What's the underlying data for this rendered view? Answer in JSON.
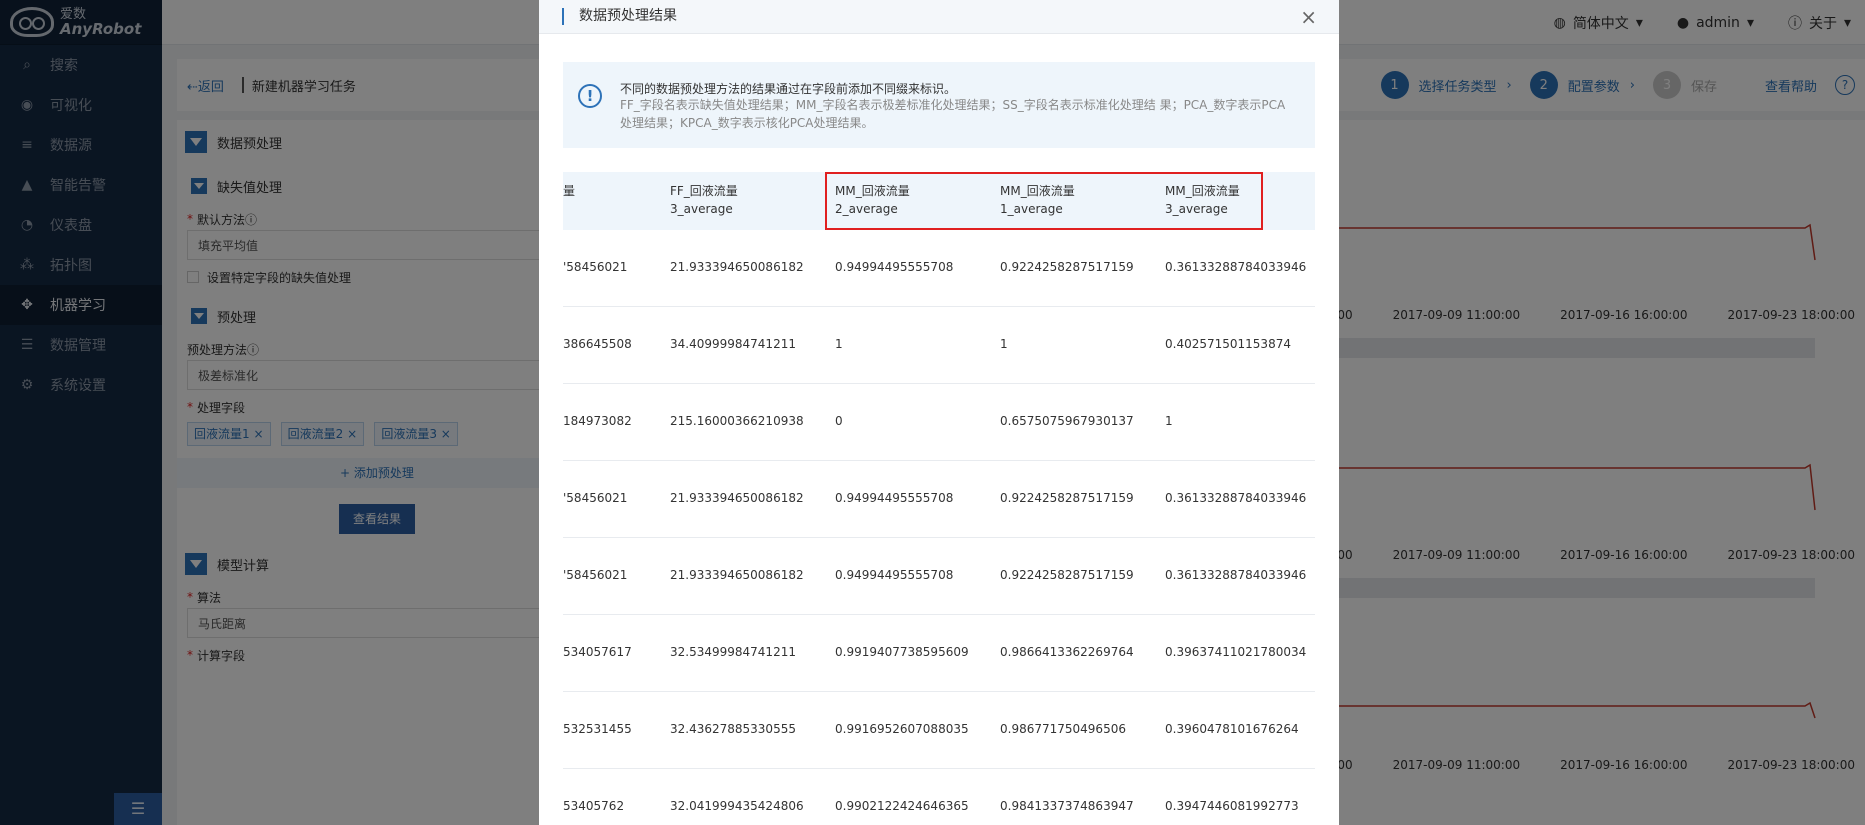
{
  "app": {
    "logo_cn": "爱数",
    "logo_en": "AnyRobot"
  },
  "sidebar": {
    "items": [
      {
        "label": "搜索",
        "icon": "search-icon"
      },
      {
        "label": "可视化",
        "icon": "eye-icon"
      },
      {
        "label": "数据源",
        "icon": "database-icon"
      },
      {
        "label": "智能告警",
        "icon": "alert-icon"
      },
      {
        "label": "仪表盘",
        "icon": "dashboard-icon"
      },
      {
        "label": "拓扑图",
        "icon": "topology-icon"
      },
      {
        "label": "机器学习",
        "icon": "ml-icon",
        "active": true
      },
      {
        "label": "数据管理",
        "icon": "data-manage-icon"
      },
      {
        "label": "系统设置",
        "icon": "gear-icon"
      }
    ]
  },
  "topbar": {
    "language": "简体中文",
    "user": "admin",
    "about": "关于"
  },
  "breadcrumb": {
    "back": "⇠返回",
    "title": "新建机器学习任务"
  },
  "steps": [
    {
      "num": "1",
      "label": "选择任务类型"
    },
    {
      "num": "2",
      "label": "配置参数"
    },
    {
      "num": "3",
      "label": "保存"
    }
  ],
  "help": "查看帮助",
  "left_panel": {
    "sec_preprocess": "数据预处理",
    "sub_missing": "缺失值处理",
    "default_method_label": "默认方法",
    "default_method_value": "填充平均值",
    "specific_field_label": "设置特定字段的缺失值处理",
    "sub_pre": "预处理",
    "pre_method_label": "预处理方法",
    "pre_method_value": "极差标准化",
    "fields_label": "处理字段",
    "tags": [
      "回液流量1",
      "回液流量2",
      "回液流量3"
    ],
    "add_pre": "添加预处理",
    "view_result": "查看结果",
    "sec_model": "模型计算",
    "algo_label": "算法",
    "algo_value": "马氏距离",
    "calc_label": "计算字段"
  },
  "charts": {
    "ticks": [
      "2017-09-09 11:00:00",
      "2017-09-16 16:00:00",
      "2017-09-23 18:00:00"
    ],
    "partial_tick": "00"
  },
  "modal": {
    "title": "数据预处理结果",
    "info_title": "不同的数据预处理方法的结果通过在字段前添加不同缀来标识。",
    "info_desc": "FF_字段名表示缺失值处理结果；MM_字段名表示极差标准化处理结果；SS_字段名表示标准化处理结 果；PCA_数字表示PCA处理结果；KPCA_数字表示核化PCA处理结果。",
    "columns": [
      {
        "line1": "量",
        "line2": ""
      },
      {
        "line1": "FF_回液流量",
        "line2": "3_average"
      },
      {
        "line1": "MM_回液流量",
        "line2": "2_average"
      },
      {
        "line1": "MM_回液流量",
        "line2": "1_average"
      },
      {
        "line1": "MM_回液流量",
        "line2": "3_average"
      }
    ],
    "rows": [
      [
        "'58456021",
        "21.933394650086182",
        "0.94994495555708",
        "0.9224258287517159",
        "0.36133288784033946"
      ],
      [
        "386645508",
        "34.40999984741211",
        "1",
        "1",
        "0.402571501153874"
      ],
      [
        "184973082",
        "215.16000366210938",
        "0",
        "0.6575075967930137",
        "1"
      ],
      [
        "'58456021",
        "21.933394650086182",
        "0.94994495555708",
        "0.9224258287517159",
        "0.36133288784033946"
      ],
      [
        "'58456021",
        "21.933394650086182",
        "0.94994495555708",
        "0.9224258287517159",
        "0.36133288784033946"
      ],
      [
        "534057617",
        "32.53499984741211",
        "0.9919407738595609",
        "0.9866413362269764",
        "0.39637411021780034"
      ],
      [
        "532531455",
        "32.43627885330555",
        "0.9916952607088035",
        "0.986771750496506",
        "0.3960478101676264"
      ],
      [
        "53405762",
        "32.041999435424806",
        "0.9902122424646365",
        "0.9841337374863947",
        "0.3947446081992773"
      ]
    ]
  }
}
